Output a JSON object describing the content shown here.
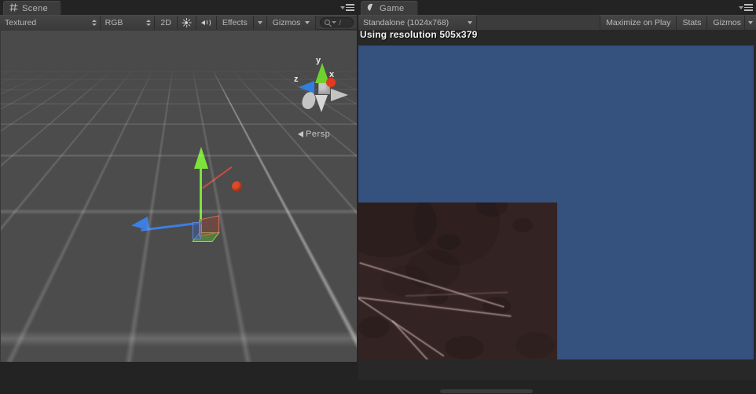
{
  "window": {
    "background_color": "#232323"
  },
  "scene_panel": {
    "tab": {
      "label": "Scene",
      "icon": "grid-hash-icon"
    },
    "panel_menu_icon": "panel-options-icon",
    "toolbar": {
      "draw_mode": {
        "label": "Textured",
        "icon": "updown-arrows-icon"
      },
      "color_mode": {
        "label": "RGB",
        "icon": "updown-arrows-icon"
      },
      "toggle_2d": {
        "label": "2D"
      },
      "lighting_icon": "sun-icon",
      "audio_icon": "speaker-icon",
      "effects": {
        "label": "Effects",
        "icon": "chevron-down-icon"
      },
      "gizmos": {
        "label": "Gizmos",
        "icon": "chevron-down-icon"
      },
      "search": {
        "value": "",
        "placeholder": "",
        "icon": "search-icon"
      }
    },
    "viewport": {
      "background_color": "#4c4c4c",
      "grid_color": "#6f6f6f",
      "projection_label": "Persp",
      "orientation_gizmo": {
        "axis_x_label": "x",
        "axis_x_color": "#e03b20",
        "axis_y_label": "y",
        "axis_y_color": "#6fd12e",
        "axis_z_label": "z",
        "axis_z_color": "#2f7fe0"
      },
      "selected_object": {
        "tool": "move-gizmo",
        "handle_y_color": "#7ee23c",
        "handle_z_color": "#3c7ee2",
        "handle_x_color": "#e04a28"
      }
    }
  },
  "game_panel": {
    "tab": {
      "label": "Game",
      "icon": "game-view-icon"
    },
    "panel_menu_icon": "panel-options-icon",
    "toolbar": {
      "resolution_dropdown": {
        "label": "Standalone (1024x768)",
        "icon": "chevron-down-icon"
      },
      "maximize_on_play": {
        "label": "Maximize on Play"
      },
      "stats": {
        "label": "Stats"
      },
      "gizmos": {
        "label": "Gizmos",
        "icon": "chevron-down-icon"
      }
    },
    "resolution_note": "Using resolution 505x379",
    "render": {
      "sky_color": "#35517e",
      "ground_color": "#342323",
      "ground_streak_color": "#e6cdc3"
    }
  }
}
